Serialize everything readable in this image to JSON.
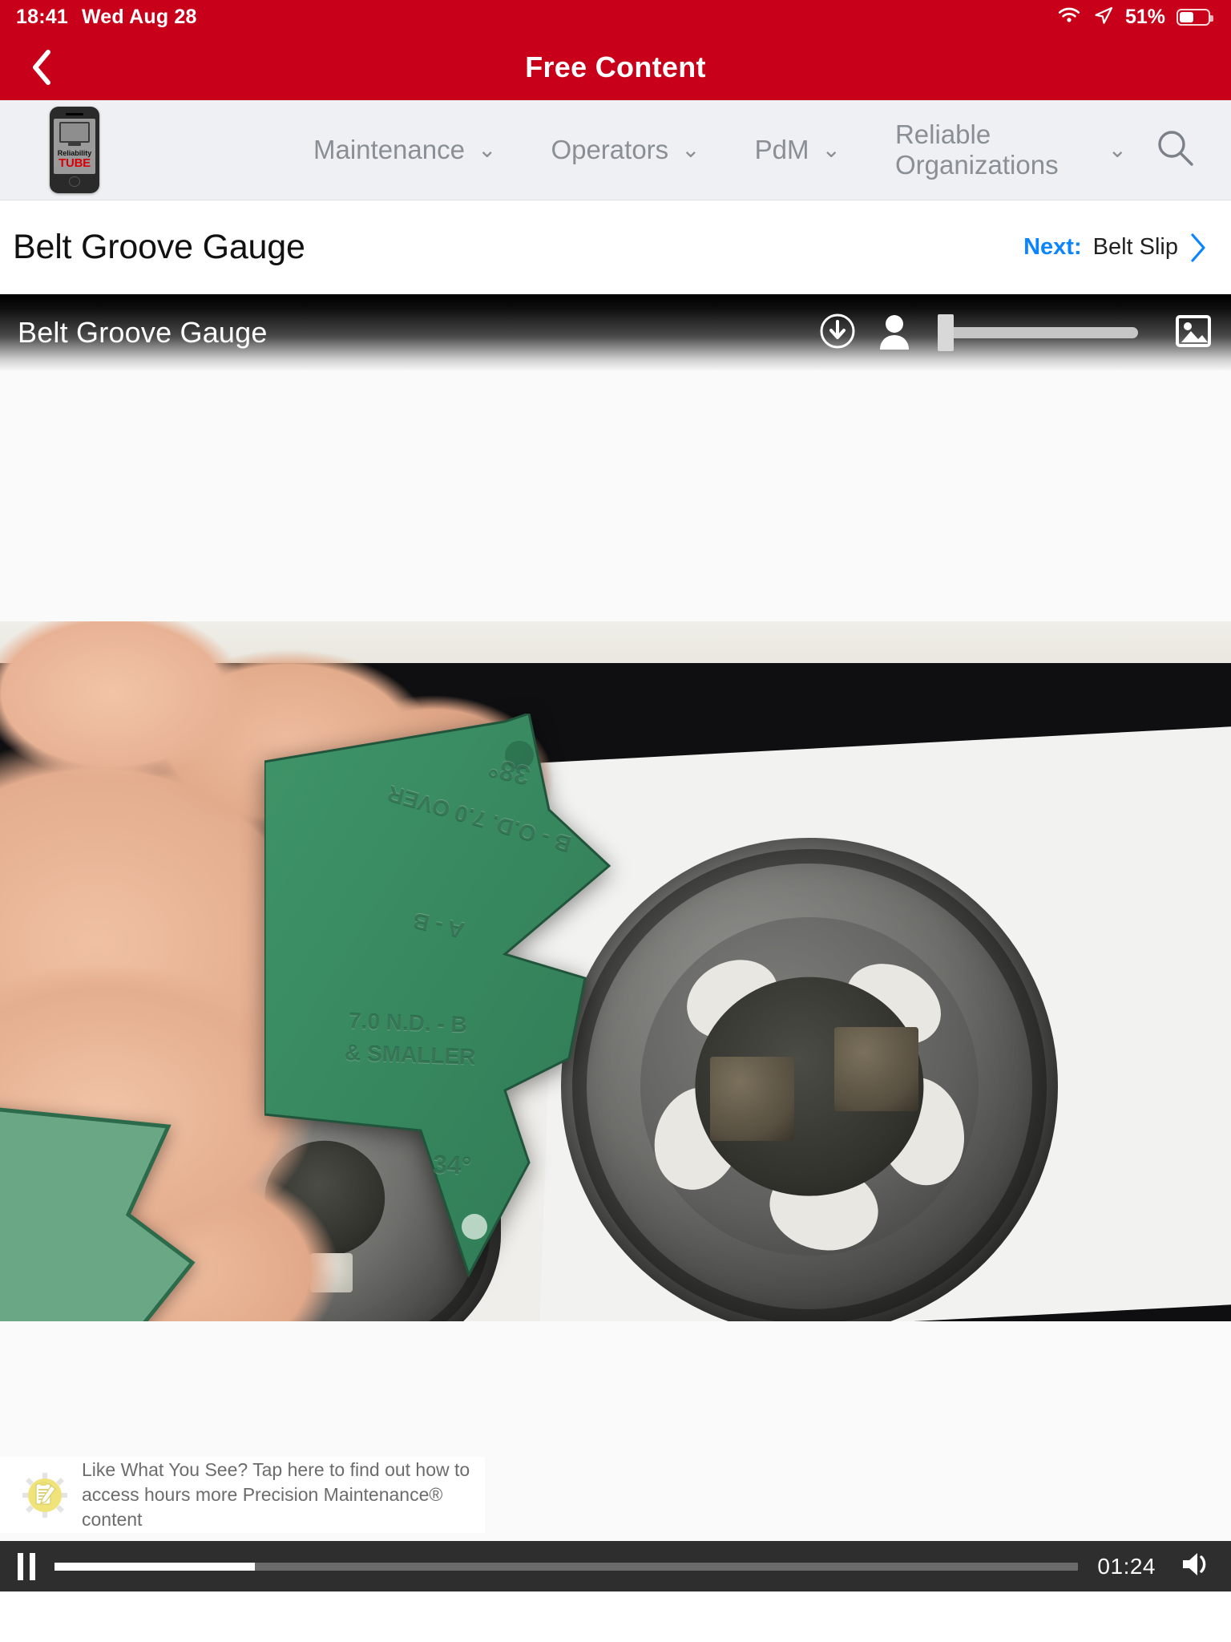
{
  "status_bar": {
    "time": "18:41",
    "date": "Wed Aug 28",
    "battery_percent": "51%",
    "wifi_icon": "wifi-icon",
    "location_icon": "location-arrow-icon",
    "battery_icon": "battery-icon",
    "accent_color": "#c80019"
  },
  "nav_bar": {
    "title": "Free Content",
    "back_icon": "chevron-left-icon",
    "background_color": "#c80019"
  },
  "site_nav": {
    "logo": {
      "line1": "Reliability",
      "line2": "TUBE",
      "icon": "phone-tv-logo"
    },
    "items": [
      {
        "label": "Maintenance",
        "caret": "⌄"
      },
      {
        "label": "Operators",
        "caret": "⌄"
      },
      {
        "label": "PdM",
        "caret": "⌄"
      },
      {
        "label": "Reliable Organizations",
        "caret": "⌄"
      }
    ],
    "search_icon": "search-icon",
    "background_color": "#eef0f3"
  },
  "title_row": {
    "page_title": "Belt Groove Gauge",
    "next_label": "Next:",
    "next_value": "Belt Slip",
    "next_chevron_icon": "chevron-right-icon",
    "link_color": "#0a84ff"
  },
  "video": {
    "overlay_title": "Belt Groove Gauge",
    "download_icon": "download-circle-icon",
    "person_icon": "person-icon",
    "image_icon": "image-icon",
    "slider_name": "brightness-slider",
    "slider_value": 0,
    "frame_description": "Hand holding a green belt groove gauge next to two V-belt sheaves on a dark bench",
    "gauge_markings": [
      "38°",
      "B - O.D. 7.0 OVER",
      "A - B",
      "7.0 N.D. - B",
      "& SMALLER",
      "34°"
    ],
    "gauge_color": "#2f7a55"
  },
  "promo": {
    "line1": "Like What You See?  Tap here to find out how to",
    "line2": "access hours more Precision Maintenance® content",
    "icon": "clipboard-gear-icon",
    "icon_color": "#efe37a"
  },
  "player": {
    "pause_icon": "pause-icon",
    "time_remaining": "01:24",
    "volume_icon": "volume-icon",
    "progress_percent": 19.6,
    "background_color": "#2e2e2e"
  }
}
